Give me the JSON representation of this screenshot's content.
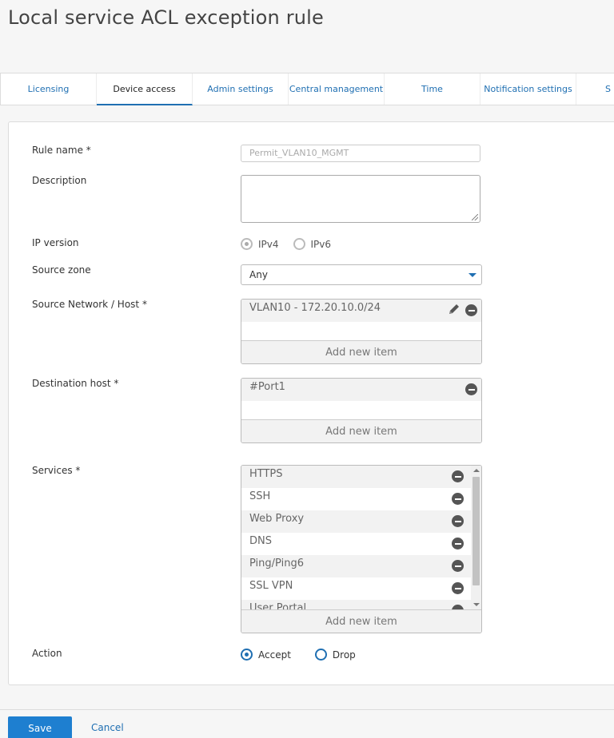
{
  "page": {
    "title": "Local service ACL exception rule"
  },
  "tabs": [
    {
      "label": "Licensing"
    },
    {
      "label": "Device access"
    },
    {
      "label": "Admin settings"
    },
    {
      "label": "Central management"
    },
    {
      "label": "Time"
    },
    {
      "label": "Notification settings"
    },
    {
      "label": "S"
    }
  ],
  "active_tab": "Device access",
  "form": {
    "rule_name": {
      "label": "Rule name *",
      "placeholder": "Permit_VLAN10_MGMT"
    },
    "description": {
      "label": "Description",
      "value": ""
    },
    "ip_version": {
      "label": "IP version",
      "options": [
        "IPv4",
        "IPv6"
      ],
      "selected": "IPv4"
    },
    "source_zone": {
      "label": "Source zone",
      "value": "Any"
    },
    "source_network": {
      "label": "Source Network / Host *",
      "items": [
        "VLAN10 - 172.20.10.0/24"
      ],
      "add_label": "Add new item"
    },
    "destination_host": {
      "label": "Destination host *",
      "items": [
        "#Port1"
      ],
      "add_label": "Add new item"
    },
    "services": {
      "label": "Services *",
      "items": [
        "HTTPS",
        "SSH",
        "Web Proxy",
        "DNS",
        "Ping/Ping6",
        "SSL VPN",
        "User Portal"
      ],
      "add_label": "Add new item"
    },
    "action": {
      "label": "Action",
      "options": [
        "Accept",
        "Drop"
      ],
      "selected": "Accept"
    }
  },
  "footer": {
    "save_label": "Save",
    "cancel_label": "Cancel"
  },
  "colors": {
    "accent": "#1f6fb2",
    "save_button": "#1e7fd0"
  }
}
